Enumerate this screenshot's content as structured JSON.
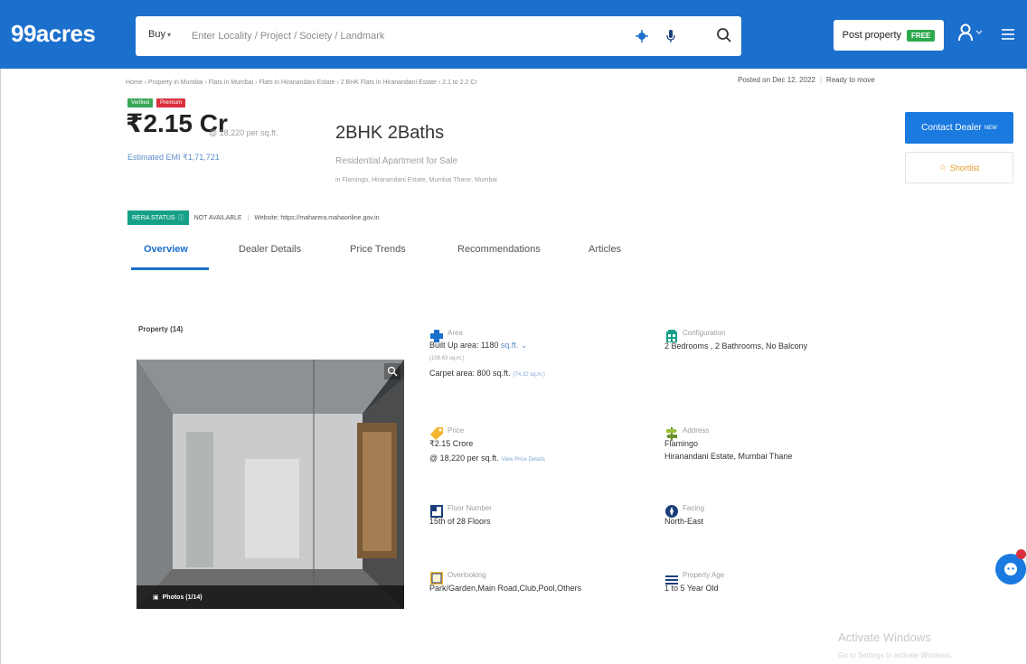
{
  "header": {
    "brand": "99acres",
    "buy_label": "Buy",
    "search_placeholder": "Enter Locality / Project / Society / Landmark",
    "post_property_label": "Post property",
    "free_badge": "FREE"
  },
  "breadcrumb": "Home › Property in Mumbai › Flats in Mumbai › Flats in Hiranandani Estate › 2 BHK Flats in Hiranandani Estate › 2.1 to 2.2 Cr",
  "posted": {
    "date": "Posted on Dec 12, 2022",
    "status": "Ready to move"
  },
  "badges": {
    "verified": "Verified",
    "premium": "Premium"
  },
  "listing": {
    "price": "₹2.15 Cr",
    "price_per_sqft": "@ 18,220 per sq.ft.",
    "emi": "Estimated EMI ₹1,71,721",
    "title": "2BHK 2Baths",
    "subtitle": "Residential Apartment for Sale",
    "location": "in Flamingo, Hiranandani Estate, Mumbai Thane, Mumbai"
  },
  "actions": {
    "contact": "Contact Dealer",
    "contact_sup": "NEW",
    "shortlist": "Shortlist"
  },
  "rera": {
    "badge": "RERA STATUS",
    "status": "NOT AVAILABLE",
    "website": "Website: https://maharera.mahaonline.gov.in"
  },
  "tabs": [
    "Overview",
    "Dealer Details",
    "Price Trends",
    "Recommendations",
    "Articles"
  ],
  "gallery": {
    "label": "Property (14)",
    "caption": "Photos (1/14)"
  },
  "details": {
    "area": {
      "label": "Area",
      "built_up": "Built Up area: 1180",
      "unit": "sq.ft.",
      "built_up_sqm": "(109.63 sq.m.)",
      "carpet": "Carpet area: 800 sq.ft.",
      "carpet_sqm": "(74.32 sq.m.)"
    },
    "configuration": {
      "label": "Configuration",
      "value": "2 Bedrooms , 2 Bathrooms, No Balcony"
    },
    "price": {
      "label": "Price",
      "value": "₹2.15 Crore",
      "per_sqft": "@ 18,220 per sq.ft.",
      "link": "View Price Details"
    },
    "address": {
      "label": "Address",
      "line1": "Flamingo",
      "line2": "Hiranandani Estate, Mumbai Thane"
    },
    "floor": {
      "label": "Floor Number",
      "value": "15th of 28 Floors"
    },
    "facing": {
      "label": "Facing",
      "value": "North-East"
    },
    "overlooking": {
      "label": "Overlooking",
      "value": "Park/Garden,Main Road,Club,Pool,Others"
    },
    "age": {
      "label": "Property Age",
      "value": "1 to 5 Year Old"
    }
  },
  "watermark": {
    "title": "Activate Windows",
    "subtitle": "Go to Settings to activate Windows."
  },
  "colors": {
    "brand_blue": "#1b6fcd",
    "cta_blue": "#1b7ae0",
    "rera_green": "#16a088",
    "premium_red": "#d9313d"
  }
}
